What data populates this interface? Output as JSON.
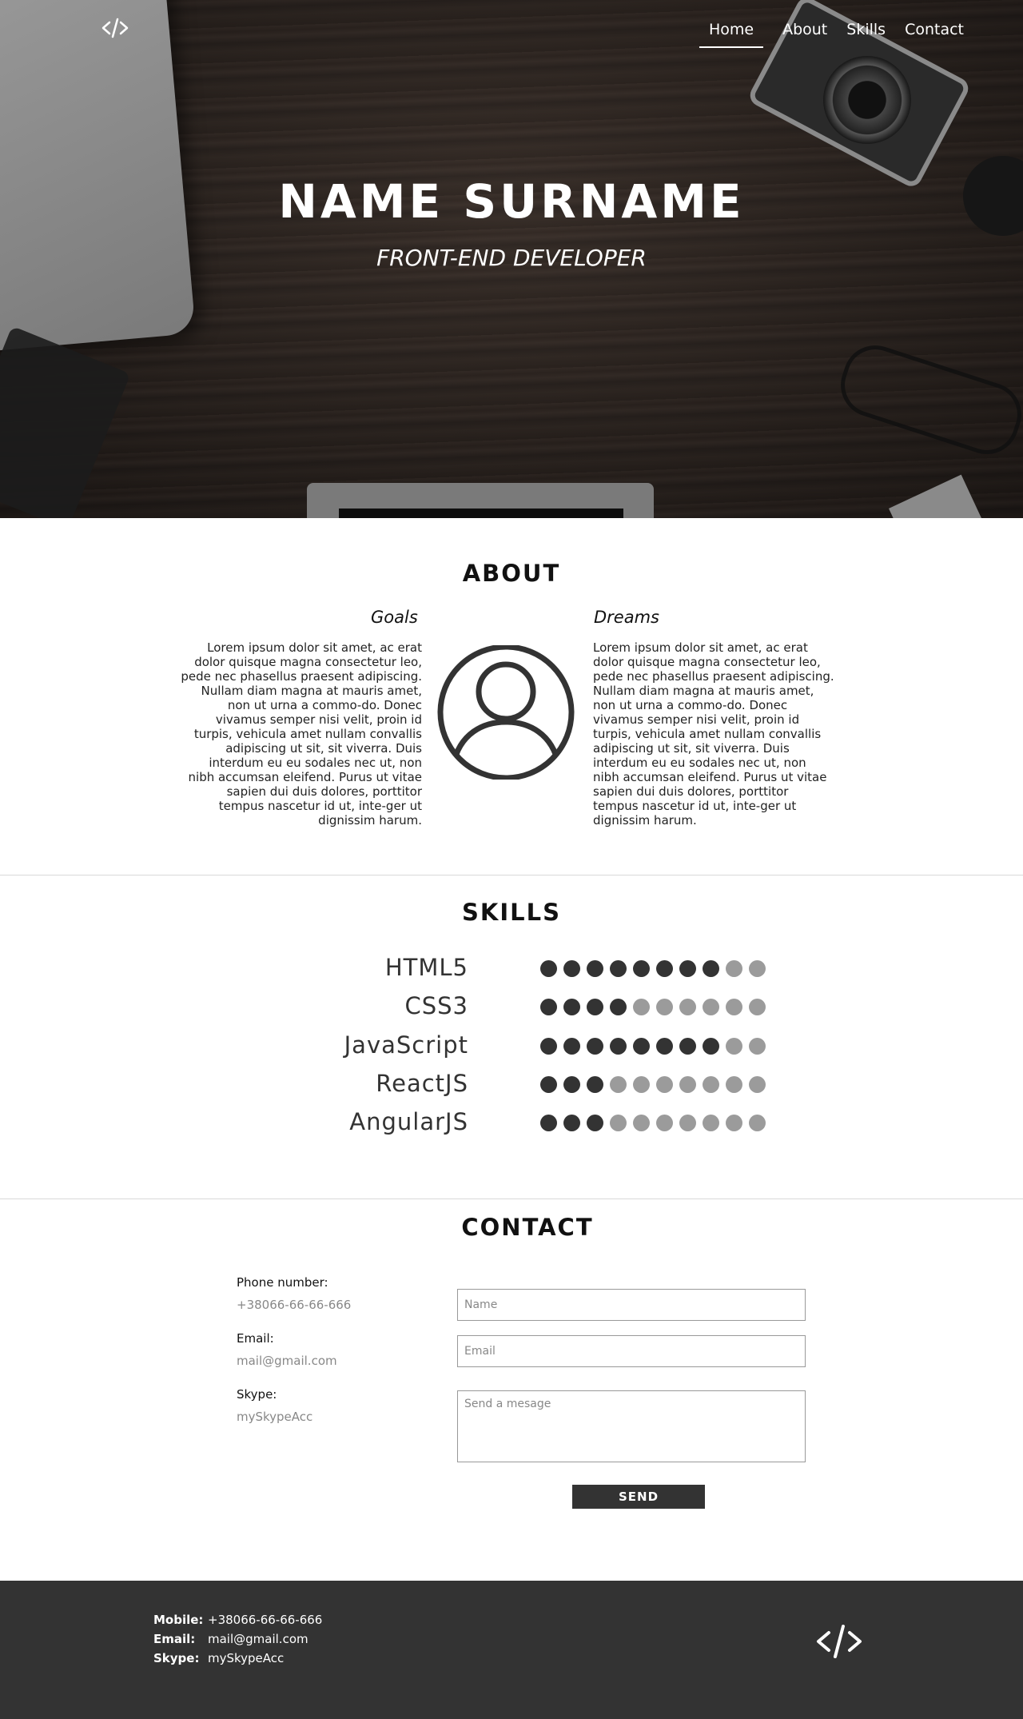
{
  "nav": {
    "logo": "code-logo-icon",
    "items": [
      {
        "label": "Home",
        "active": true
      },
      {
        "label": "About",
        "active": false
      },
      {
        "label": "Skills",
        "active": false
      },
      {
        "label": "Contact",
        "active": false
      }
    ]
  },
  "hero": {
    "title": "NAME SURNAME",
    "subtitle": "FRONT-END DEVELOPER"
  },
  "about": {
    "title": "ABOUT",
    "goals": {
      "heading": "Goals",
      "text": "Lorem ipsum dolor sit amet, ac erat dolor quisque magna consectetur leo, pede nec phasellus praesent adipiscing. Nullam diam magna at mauris amet, non ut urna a commo-do. Donec vivamus semper nisi velit, proin id turpis, vehicula amet nullam convallis adipiscing ut sit, sit viverra. Duis interdum eu eu sodales nec ut, non nibh accumsan eleifend. Purus ut vitae sapien dui duis dolores, porttitor tempus nascetur id ut, inte-ger ut dignissim harum."
    },
    "dreams": {
      "heading": "Dreams",
      "text": "Lorem ipsum dolor sit amet, ac erat dolor quisque magna consectetur leo, pede nec phasellus praesent adipiscing. Nullam diam magna at mauris amet, non ut urna a commo-do. Donec vivamus semper nisi velit, proin id turpis, vehicula amet nullam convallis adipiscing ut sit, sit viverra. Duis interdum eu eu sodales nec ut, non nibh accumsan eleifend. Purus ut vitae sapien dui duis dolores, porttitor tempus nascetur id ut, inte-ger ut dignissim harum."
    },
    "avatar_icon": "user-avatar-icon"
  },
  "skills": {
    "title": "SKILLS",
    "max": 10,
    "items": [
      {
        "name": "HTML5",
        "level": 8
      },
      {
        "name": "CSS3",
        "level": 4
      },
      {
        "name": "JavaScript",
        "level": 8
      },
      {
        "name": "ReactJS",
        "level": 3
      },
      {
        "name": "AngularJS",
        "level": 3
      }
    ],
    "colors": {
      "filled": "#333333",
      "empty": "#9b9b9b"
    }
  },
  "contact": {
    "title": "CONTACT",
    "phone_label": "Phone number:",
    "phone_value": "+38066-66-66-666",
    "email_label": "Email:",
    "email_value": "mail@gmail.com",
    "skype_label": "Skype:",
    "skype_value": "mySkypeAcc",
    "form": {
      "name_placeholder": "Name",
      "email_placeholder": "Email",
      "message_placeholder": "Send a mesage",
      "send_label": "SEND"
    }
  },
  "footer": {
    "mobile_label": "Mobile:",
    "mobile_value": "+38066-66-66-666",
    "email_label": "Email:",
    "email_value": "mail@gmail.com",
    "skype_label": "Skype:",
    "skype_value": "mySkypeAcc",
    "logo": "code-logo-icon",
    "background": "#333333"
  }
}
